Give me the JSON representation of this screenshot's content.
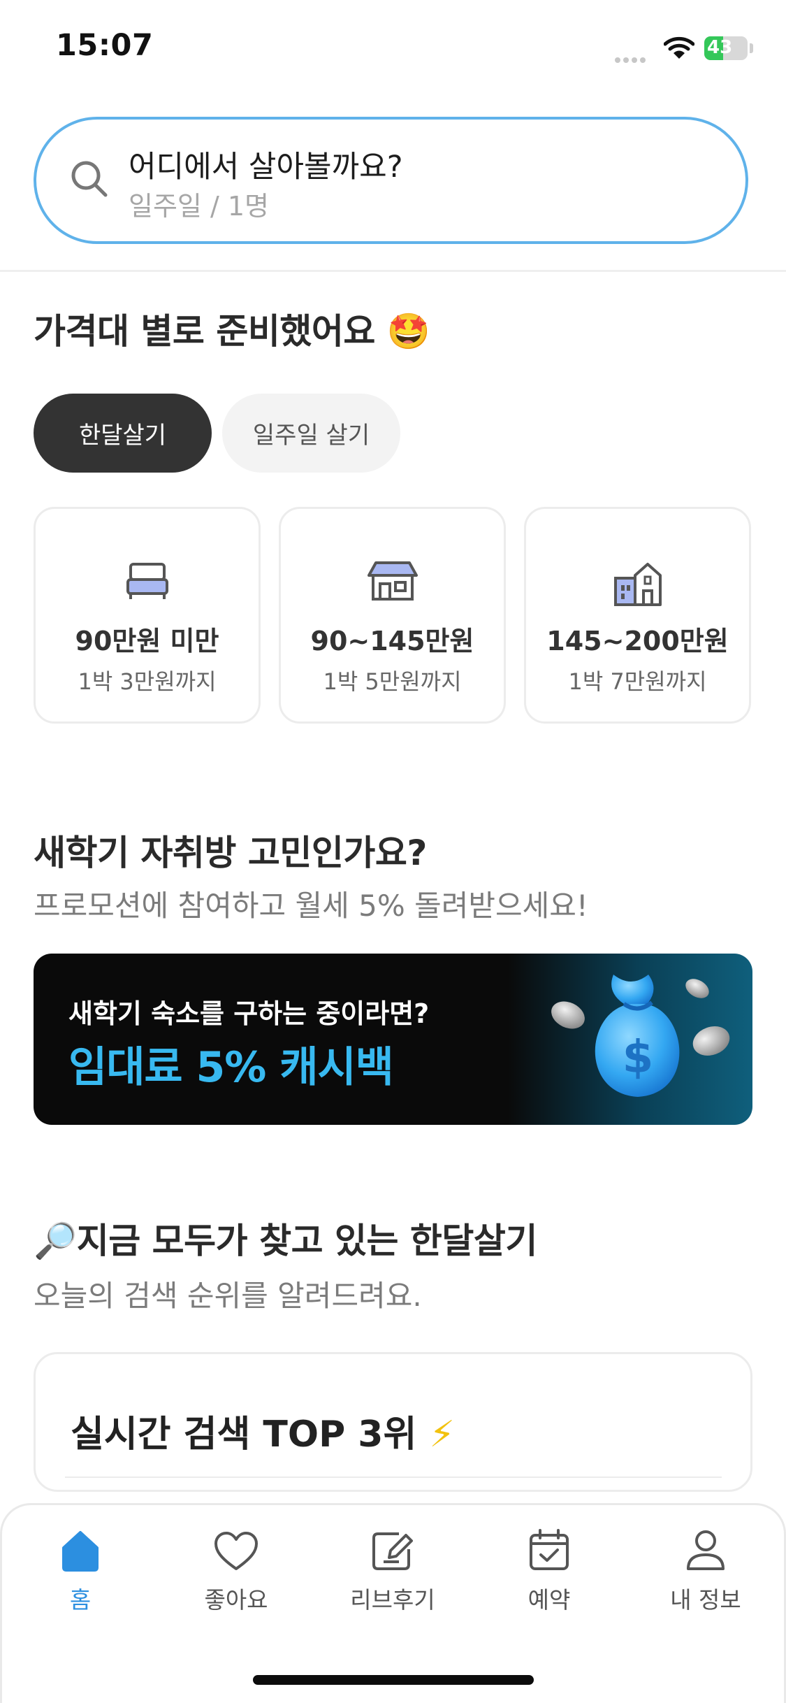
{
  "status_bar": {
    "time": "15:07",
    "battery": "43"
  },
  "search": {
    "title": "어디에서 살아볼까요?",
    "subtitle": "일주일 / 1명"
  },
  "price_section": {
    "heading": "가격대 별로 준비했어요",
    "emoji": "🤩",
    "tabs": [
      {
        "label": "한달살기",
        "selected": true
      },
      {
        "label": "일주일 살기",
        "selected": false
      }
    ],
    "cards": [
      {
        "icon": "bed-icon",
        "title": "90만원 미만",
        "subtitle": "1박 3만원까지"
      },
      {
        "icon": "house-icon",
        "title": "90~145만원",
        "subtitle": "1박 5만원까지"
      },
      {
        "icon": "building-icon",
        "title": "145~200만원",
        "subtitle": "1박 7만원까지"
      }
    ]
  },
  "promo_section": {
    "heading": "새학기 자취방 고민인가요?",
    "subheading": "프로모션에 참여하고 월세 5% 돌려받으세요!",
    "banner": {
      "line1": "새학기 숙소를 구하는 중이라면?",
      "line2": "임대료 5% 캐시백"
    }
  },
  "trending_section": {
    "emoji": "🔎",
    "heading": "지금 모두가 찾고 있는 한달살기",
    "subheading": "오늘의 검색 순위를 알려드려요.",
    "card_title": "실시간 검색 TOP 3위",
    "card_emoji": "⚡"
  },
  "nav": {
    "items": [
      {
        "label": "홈",
        "icon": "home-icon",
        "active": true
      },
      {
        "label": "좋아요",
        "icon": "heart-icon",
        "active": false
      },
      {
        "label": "리브후기",
        "icon": "review-icon",
        "active": false
      },
      {
        "label": "예약",
        "icon": "calendar-icon",
        "active": false
      },
      {
        "label": "내 정보",
        "icon": "profile-icon",
        "active": false
      }
    ]
  },
  "colors": {
    "accent": "#2c8fe0",
    "search_border": "#5fb2ea",
    "chip_active": "#333333",
    "banner_text": "#38b9f0"
  }
}
